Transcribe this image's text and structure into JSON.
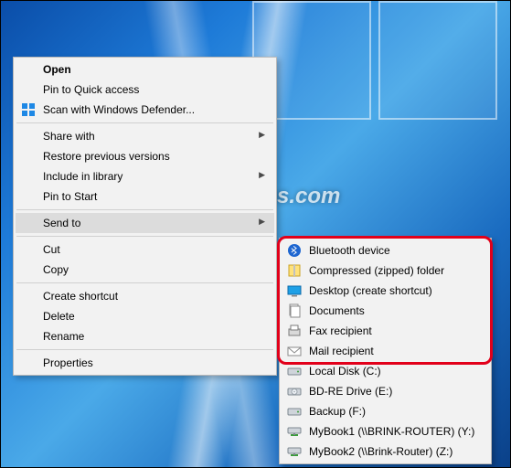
{
  "watermark": "TenForums.com",
  "main_menu": {
    "groups": [
      [
        {
          "label": "Open",
          "bold": true
        },
        {
          "label": "Pin to Quick access"
        },
        {
          "label": "Scan with Windows Defender...",
          "icon": "defender-icon"
        }
      ],
      [
        {
          "label": "Share with",
          "submenu": true
        },
        {
          "label": "Restore previous versions"
        },
        {
          "label": "Include in library",
          "submenu": true
        },
        {
          "label": "Pin to Start"
        }
      ],
      [
        {
          "label": "Send to",
          "submenu": true,
          "hover": true
        }
      ],
      [
        {
          "label": "Cut"
        },
        {
          "label": "Copy"
        }
      ],
      [
        {
          "label": "Create shortcut"
        },
        {
          "label": "Delete"
        },
        {
          "label": "Rename"
        }
      ],
      [
        {
          "label": "Properties"
        }
      ]
    ]
  },
  "sub_menu": {
    "items": [
      {
        "label": "Bluetooth device",
        "icon": "bluetooth-icon",
        "hl": true
      },
      {
        "label": "Compressed (zipped) folder",
        "icon": "zip-icon",
        "hl": true
      },
      {
        "label": "Desktop (create shortcut)",
        "icon": "desktop-icon",
        "hl": true
      },
      {
        "label": "Documents",
        "icon": "documents-icon",
        "hl": true
      },
      {
        "label": "Fax recipient",
        "icon": "fax-icon",
        "hl": true
      },
      {
        "label": "Mail recipient",
        "icon": "mail-icon",
        "hl": true
      },
      {
        "label": "Local Disk (C:)",
        "icon": "disk-icon"
      },
      {
        "label": "BD-RE Drive (E:)",
        "icon": "optical-icon"
      },
      {
        "label": "Backup (F:)",
        "icon": "disk-icon"
      },
      {
        "label": "MyBook1 (\\\\BRINK-ROUTER) (Y:)",
        "icon": "netdrive-icon"
      },
      {
        "label": "MyBook2 (\\\\Brink-Router) (Z:)",
        "icon": "netdrive-icon"
      }
    ]
  }
}
